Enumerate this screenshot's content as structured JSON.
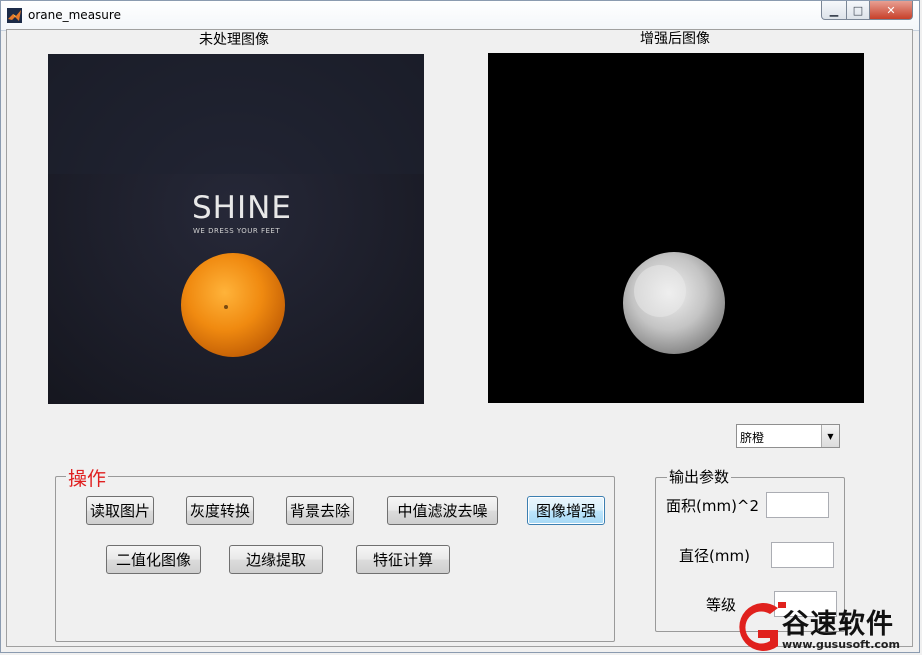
{
  "window": {
    "title": "orane_measure",
    "controls": {
      "minimize": "▁",
      "maximize": "□",
      "close": "✕"
    },
    "icon": "matlab-logo-icon"
  },
  "axes": {
    "raw_title": "未处理图像",
    "enhanced_title": "增强后图像"
  },
  "raw_image": {
    "brand_text": "SHINE",
    "tagline": "WE DRESS YOUR FEET",
    "subject": "orange"
  },
  "variety_select": {
    "selected": "脐橙"
  },
  "operations_panel": {
    "title": "操作",
    "buttons": {
      "read_image": "读取图片",
      "grayscale": "灰度转换",
      "remove_background": "背景去除",
      "median_filter": "中值滤波去噪",
      "enhance": "图像增强",
      "binarize": "二值化图像",
      "edge_extract": "边缘提取",
      "feature_calc": "特征计算"
    }
  },
  "output_panel": {
    "title": "输出参数",
    "area_label": "面积(mm)^2",
    "area_value": "",
    "diameter_label": "直径(mm)",
    "diameter_value": "",
    "grade_label": "等级",
    "grade_value": ""
  },
  "watermark": {
    "text": "谷速软件",
    "url": "www.gususoft.com",
    "accent_color": "#e0211d"
  },
  "colors": {
    "close_button": "#c7402a",
    "panel_title_red": "#e02020",
    "orange_fruit": "#f08a10"
  }
}
